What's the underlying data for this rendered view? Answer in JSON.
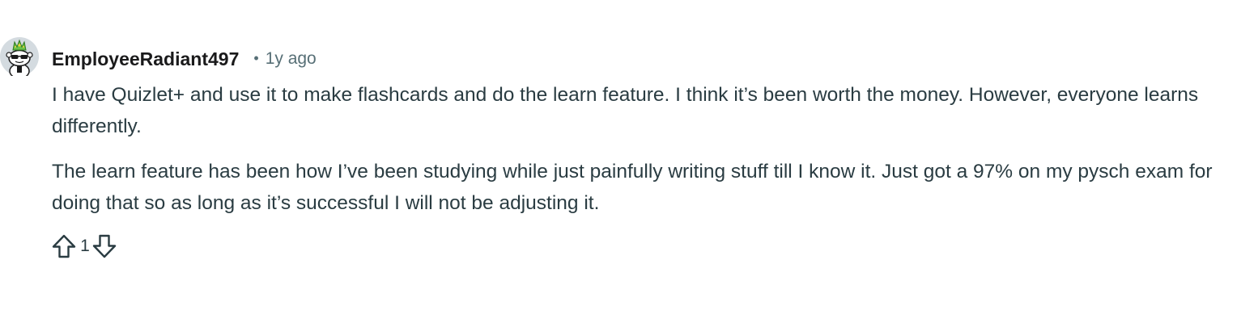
{
  "comment": {
    "author": "EmployeeRadiant497",
    "separator": "•",
    "time_ago": "1y ago",
    "avatar_icon": "snoo-avatar-with-sunglasses-and-crown",
    "paragraphs": [
      "I have Quizlet+ and use it to make flashcards and do the learn feature. I think it’s been worth the money. However, everyone learns differently.",
      "The learn feature has been how I’ve been studying while just painfully writing stuff till I know it. Just got a 97% on my pysch exam for doing that so as long as it’s successful I will not be adjusting it."
    ],
    "actions": {
      "upvote_icon": "upvote-arrow-icon",
      "vote_count": "1",
      "downvote_icon": "downvote-arrow-icon"
    }
  },
  "colors": {
    "text": "#2a3c42",
    "author": "#1a1a1b",
    "meta": "#576f76",
    "background": "#ffffff"
  }
}
